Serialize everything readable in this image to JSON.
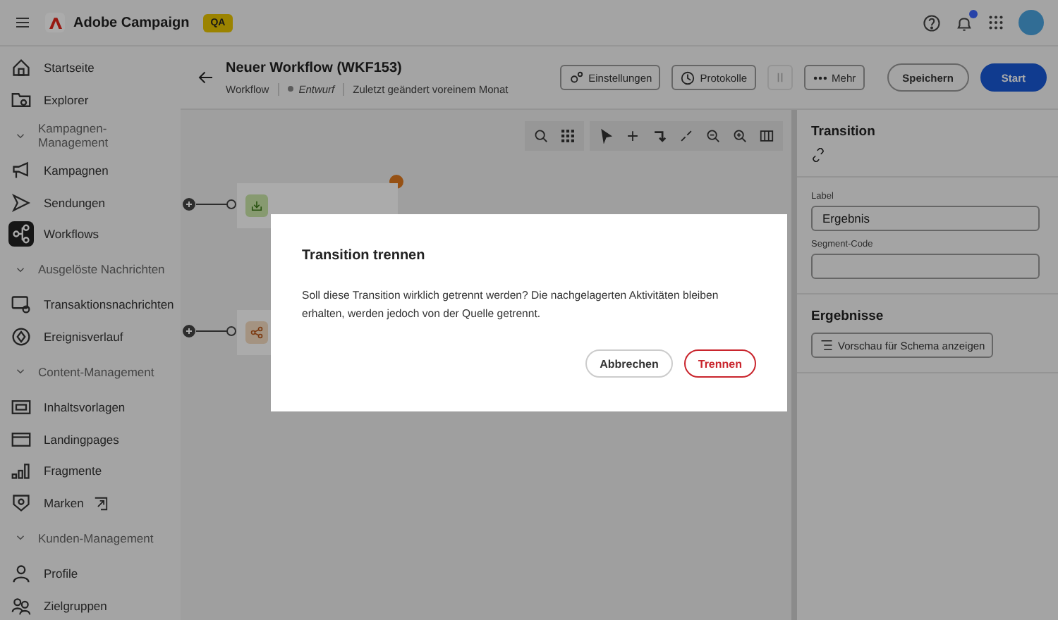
{
  "top_bar": {
    "app_name": "Adobe Campaign",
    "environment_badge": "QA",
    "notifications_unread": true
  },
  "sidebar": {
    "items": [
      {
        "kind": "item",
        "label": "Startseite",
        "selected": false
      },
      {
        "kind": "item",
        "label": "Explorer",
        "selected": false
      },
      {
        "kind": "section",
        "label": "Kampagnen-Management",
        "expanded": true
      },
      {
        "kind": "item",
        "label": "Kampagnen",
        "selected": false
      },
      {
        "kind": "item",
        "label": "Sendungen",
        "selected": false
      },
      {
        "kind": "item",
        "label": "Workflows",
        "selected": true
      },
      {
        "kind": "section",
        "label": "Ausgelöste Nachrichten",
        "expanded": true
      },
      {
        "kind": "item",
        "label": "Transaktionsnachrichten",
        "selected": false
      },
      {
        "kind": "item",
        "label": "Ereignisverlauf",
        "selected": false
      },
      {
        "kind": "section",
        "label": "Content-Management",
        "expanded": true
      },
      {
        "kind": "item",
        "label": "Inhaltsvorlagen",
        "selected": false
      },
      {
        "kind": "item",
        "label": "Landingpages",
        "selected": false
      },
      {
        "kind": "item",
        "label": "Fragmente",
        "selected": false
      },
      {
        "kind": "item",
        "label": "Marken",
        "selected": false,
        "external": true
      },
      {
        "kind": "section",
        "label": "Kunden-Management",
        "expanded": true
      },
      {
        "kind": "item",
        "label": "Profile",
        "selected": false
      },
      {
        "kind": "item",
        "label": "Zielgruppen",
        "selected": false
      }
    ]
  },
  "header": {
    "title": "Neuer Workflow (WKF153)",
    "type": "Workflow",
    "status": "Entwurf",
    "modified": "Zuletzt geändert voreinem Monat",
    "buttons": [
      {
        "kind": "settings",
        "label": "Einstellungen"
      },
      {
        "kind": "history",
        "label": "Protokolle"
      },
      {
        "kind": "pause"
      },
      {
        "kind": "more",
        "label": "Mehr"
      },
      {
        "kind": "secondary",
        "label": "Speichern"
      },
      {
        "kind": "primary",
        "label": "Start"
      }
    ]
  },
  "canvas": {
    "nodes": [
      {
        "kind": "save",
        "warning": true
      },
      {
        "kind": "split",
        "warning": false
      }
    ]
  },
  "properties_panel": {
    "title": "Transition",
    "fields": [
      {
        "label": "Label",
        "value": "Ergebnis"
      },
      {
        "label": "Segment-Code"
      }
    ],
    "section_title": "Ergebnisse",
    "preview_button": "Vorschau für Schema anzeigen"
  },
  "dialog": {
    "title": "Transition trennen",
    "message": "Soll diese Transition wirklich getrennt werden? Die nachgelagerten Aktivitäten bleiben erhalten, werden jedoch von der Quelle getrennt.",
    "buttons": [
      {
        "kind": "secondary",
        "label": "Abbrechen"
      },
      {
        "kind": "negative",
        "label": "Trennen"
      }
    ]
  }
}
